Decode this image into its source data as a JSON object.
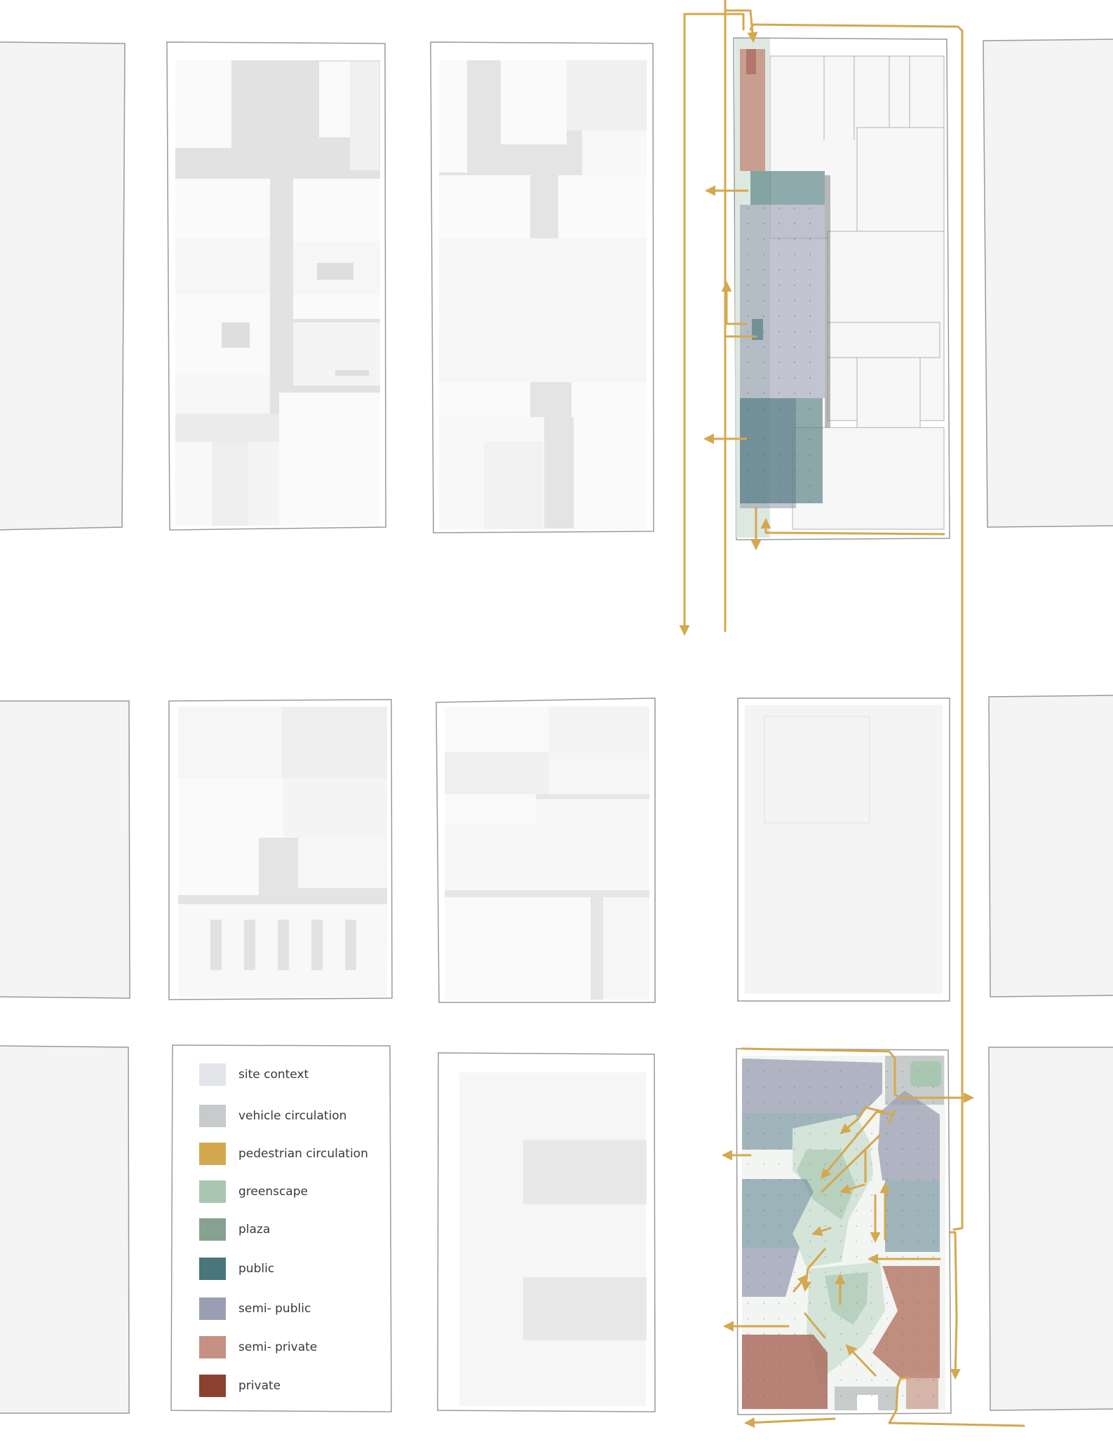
{
  "legend": {
    "items": [
      {
        "label": "site context",
        "color": "#e4e5ea"
      },
      {
        "label": "vehicle circulation",
        "color": "#c7cbcb"
      },
      {
        "label": "pedestrian circulation",
        "color": "#d4a84e"
      },
      {
        "label": "greenscape",
        "color": "#a9c6b1"
      },
      {
        "label": "plaza",
        "color": "#86a291"
      },
      {
        "label": "public",
        "color": "#48767a"
      },
      {
        "label": "semi- public",
        "color": "#9a9eb2"
      },
      {
        "label": "semi- private",
        "color": "#c49183"
      },
      {
        "label": "private",
        "color": "#8b412f"
      }
    ]
  },
  "colors": {
    "background": "#ffffff",
    "block_outline": "#9a9a9a",
    "block_fill": "#f4f4f4",
    "building_fill": "#fafafa",
    "shadow": "#dedede",
    "pedestrian_path": "#d4a84e"
  },
  "icons": {
    "arrow": "arrowhead-icon"
  }
}
